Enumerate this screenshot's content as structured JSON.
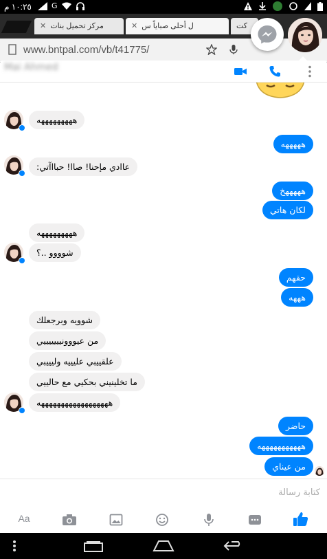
{
  "status_bar": {
    "time": "١٠:٢٥ م",
    "network_label": "G"
  },
  "browser": {
    "tabs": [
      {
        "label": "مركز تحميل بنات"
      },
      {
        "label": "ل أحلى صباياً س"
      },
      {
        "label": "كت"
      }
    ],
    "url": "www.bntpal.com/vb/t41775/"
  },
  "chat": {
    "contact_name": "Mai Ahmed",
    "messages": [
      {
        "side": "in",
        "text": "هههههههههه"
      },
      {
        "side": "out",
        "text": "هههههه"
      },
      {
        "side": "in",
        "text": "عاادي مإحنا! صاا! حبااآتي:"
      },
      {
        "side": "out",
        "text": "هههههخ"
      },
      {
        "side": "out",
        "text": "لكان هاتي"
      },
      {
        "side": "in",
        "text": "هههههههههه"
      },
      {
        "side": "in",
        "text": "شوووو ..؟"
      },
      {
        "side": "out",
        "text": "حقهم"
      },
      {
        "side": "out",
        "text": "هههه"
      },
      {
        "side": "in",
        "text": "شوويه وبرجعلك"
      },
      {
        "side": "in",
        "text": "من عيووونيييييييي"
      },
      {
        "side": "in",
        "text": "علقييبي عليييه وليييبي"
      },
      {
        "side": "in",
        "text": "ما تخلينيني بحكيي مع حالييي"
      },
      {
        "side": "in",
        "text": "ههههههههههههههههههه"
      },
      {
        "side": "out",
        "text": "حاضر"
      },
      {
        "side": "out",
        "text": "هههههههههههه"
      },
      {
        "side": "out",
        "text": "من عيناي"
      }
    ],
    "composer_placeholder": "كتابة رسالة",
    "toolbar": {
      "aa_label": "Aa"
    }
  },
  "colors": {
    "messenger_blue": "#0084ff",
    "incoming_bubble": "#f1f0f0",
    "icon_gray": "#8e9197"
  }
}
